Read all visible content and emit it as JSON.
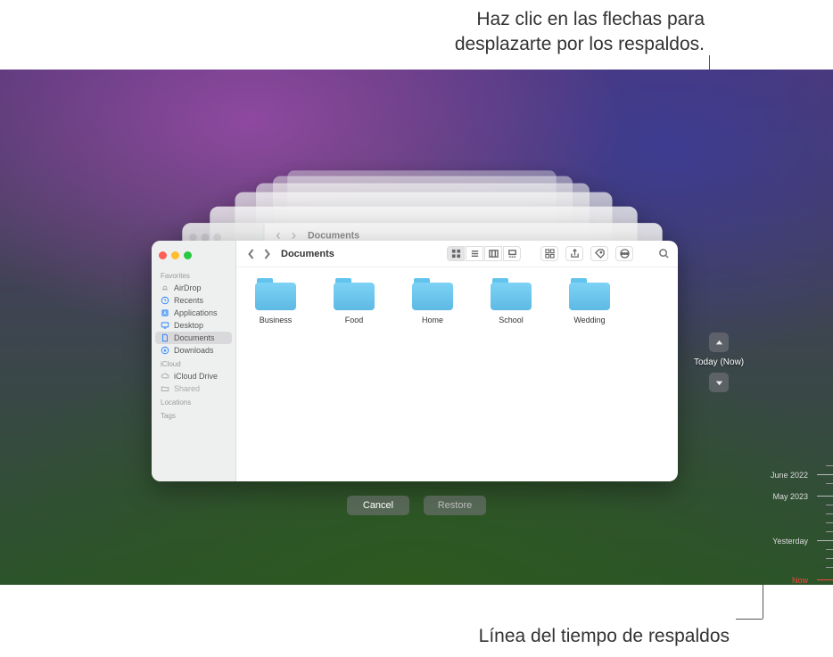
{
  "annotations": {
    "top_line1": "Haz clic en las flechas para",
    "top_line2": "desplazarte por los respaldos.",
    "bottom": "Línea del tiempo de respaldos"
  },
  "finder": {
    "title": "Documents",
    "sidebar": {
      "favorites_header": "Favorites",
      "airdrop": "AirDrop",
      "recents": "Recents",
      "applications": "Applications",
      "desktop": "Desktop",
      "documents": "Documents",
      "downloads": "Downloads",
      "icloud_header": "iCloud",
      "icloud_drive": "iCloud Drive",
      "shared": "Shared",
      "locations_header": "Locations",
      "tags_header": "Tags"
    },
    "folders": [
      {
        "label": "Business"
      },
      {
        "label": "Food"
      },
      {
        "label": "Home"
      },
      {
        "label": "School"
      },
      {
        "label": "Wedding"
      }
    ]
  },
  "actions": {
    "cancel": "Cancel",
    "restore": "Restore"
  },
  "nav": {
    "current_label": "Today (Now)"
  },
  "timeline": {
    "labels": [
      "June 2022",
      "May 2023",
      "Yesterday",
      "Now"
    ]
  }
}
